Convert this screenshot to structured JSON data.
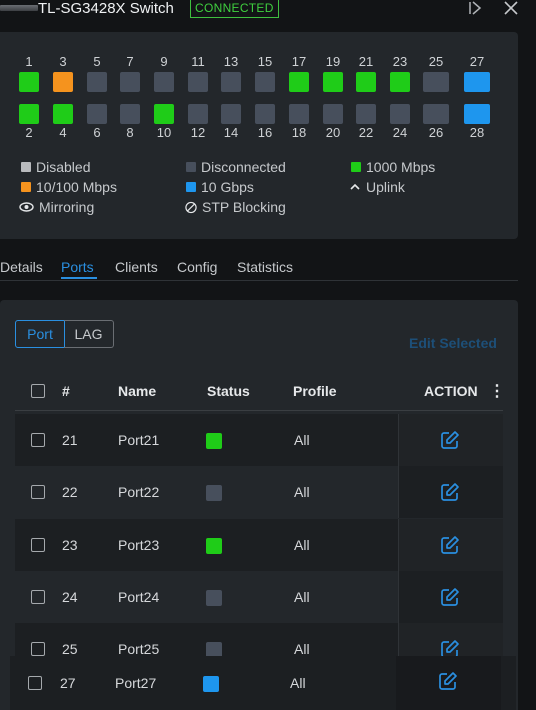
{
  "header": {
    "title": "TL-SG3428X Switch",
    "status_badge": "CONNECTED",
    "collapse_icon": "panel-collapse-icon",
    "close_icon": "close-icon"
  },
  "ports_top_row": [
    {
      "num": "1",
      "state": "1000"
    },
    {
      "num": "3",
      "state": "10/100"
    },
    {
      "num": "5",
      "state": "disconnected"
    },
    {
      "num": "7",
      "state": "disconnected"
    },
    {
      "num": "9",
      "state": "disconnected"
    },
    {
      "num": "11",
      "state": "disconnected"
    },
    {
      "num": "13",
      "state": "disconnected"
    },
    {
      "num": "15",
      "state": "disconnected"
    },
    {
      "num": "17",
      "state": "1000"
    },
    {
      "num": "19",
      "state": "1000"
    },
    {
      "num": "21",
      "state": "1000"
    },
    {
      "num": "23",
      "state": "1000"
    },
    {
      "num": "25",
      "state": "disconnected"
    },
    {
      "num": "27",
      "state": "10g"
    }
  ],
  "ports_bottom_row": [
    {
      "num": "2",
      "state": "1000"
    },
    {
      "num": "4",
      "state": "1000"
    },
    {
      "num": "6",
      "state": "disconnected"
    },
    {
      "num": "8",
      "state": "disconnected"
    },
    {
      "num": "10",
      "state": "1000"
    },
    {
      "num": "12",
      "state": "disconnected"
    },
    {
      "num": "14",
      "state": "disconnected"
    },
    {
      "num": "16",
      "state": "disconnected"
    },
    {
      "num": "18",
      "state": "disconnected"
    },
    {
      "num": "20",
      "state": "disconnected"
    },
    {
      "num": "22",
      "state": "disconnected"
    },
    {
      "num": "24",
      "state": "disconnected"
    },
    {
      "num": "26",
      "state": "disconnected"
    },
    {
      "num": "28",
      "state": "10g"
    }
  ],
  "colors": {
    "disabled": "#b9bbbe",
    "disconnected": "#474f5c",
    "1000": "#1fcc18",
    "10/100": "#f5931e",
    "10g": "#1e96ee",
    "accent": "#2a8fe0"
  },
  "legend": {
    "disabled": "Disabled",
    "disconnected": "Disconnected",
    "gig": "1000 Mbps",
    "fast": "10/100 Mbps",
    "tengig": "10 Gbps",
    "uplink": "Uplink",
    "mirroring": "Mirroring",
    "stp": "STP Blocking"
  },
  "tabs": [
    "Details",
    "Ports",
    "Clients",
    "Config",
    "Statistics"
  ],
  "active_tab": "Ports",
  "toggle": {
    "port": "Port",
    "lag": "LAG",
    "selected": "Port"
  },
  "edit_selected": "Edit Selected",
  "table": {
    "headers": {
      "num": "#",
      "name": "Name",
      "status": "Status",
      "profile": "Profile",
      "action": "ACTION"
    },
    "rows": [
      {
        "num": "21",
        "name": "Port21",
        "status": "1000",
        "profile": "All"
      },
      {
        "num": "22",
        "name": "Port22",
        "status": "disconnected",
        "profile": "All"
      },
      {
        "num": "23",
        "name": "Port23",
        "status": "1000",
        "profile": "All"
      },
      {
        "num": "24",
        "name": "Port24",
        "status": "disconnected",
        "profile": "All"
      },
      {
        "num": "25",
        "name": "Port25",
        "status": "disconnected",
        "profile": "All"
      }
    ],
    "dragging_row": {
      "num": "27",
      "name": "Port27",
      "status": "10g",
      "profile": "All"
    }
  }
}
